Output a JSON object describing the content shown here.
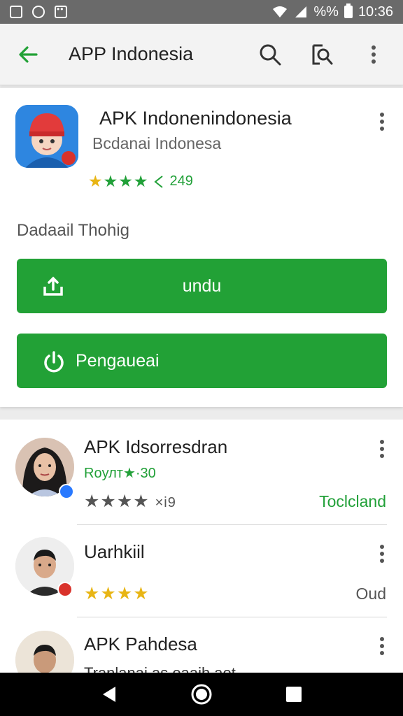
{
  "status_bar": {
    "time": "10:36",
    "battery": "%%"
  },
  "appbar": {
    "title": "APP Indonesia"
  },
  "app": {
    "title": "APK Indonenindonesia",
    "subtitle": "Bcdanai Indonesa",
    "rating_count": "249",
    "detail_label": "Dadaail Thohig"
  },
  "buttons": {
    "download_label": "undu",
    "install_label": "Pengaueai"
  },
  "list": [
    {
      "title": "APK Idsorresdran",
      "sub": "Roулт★·30",
      "rating": "★★★★",
      "rating_text": "×i9",
      "right_text": "Toclcland"
    },
    {
      "title": "Uarhkiil",
      "rating": "★★★★",
      "right_text": "Oud"
    },
    {
      "title": "APK Pahdesa",
      "sub": "Tranlanai as oaaih aot"
    }
  ],
  "colors": {
    "accent": "#22a136",
    "star": "#e8b514"
  }
}
